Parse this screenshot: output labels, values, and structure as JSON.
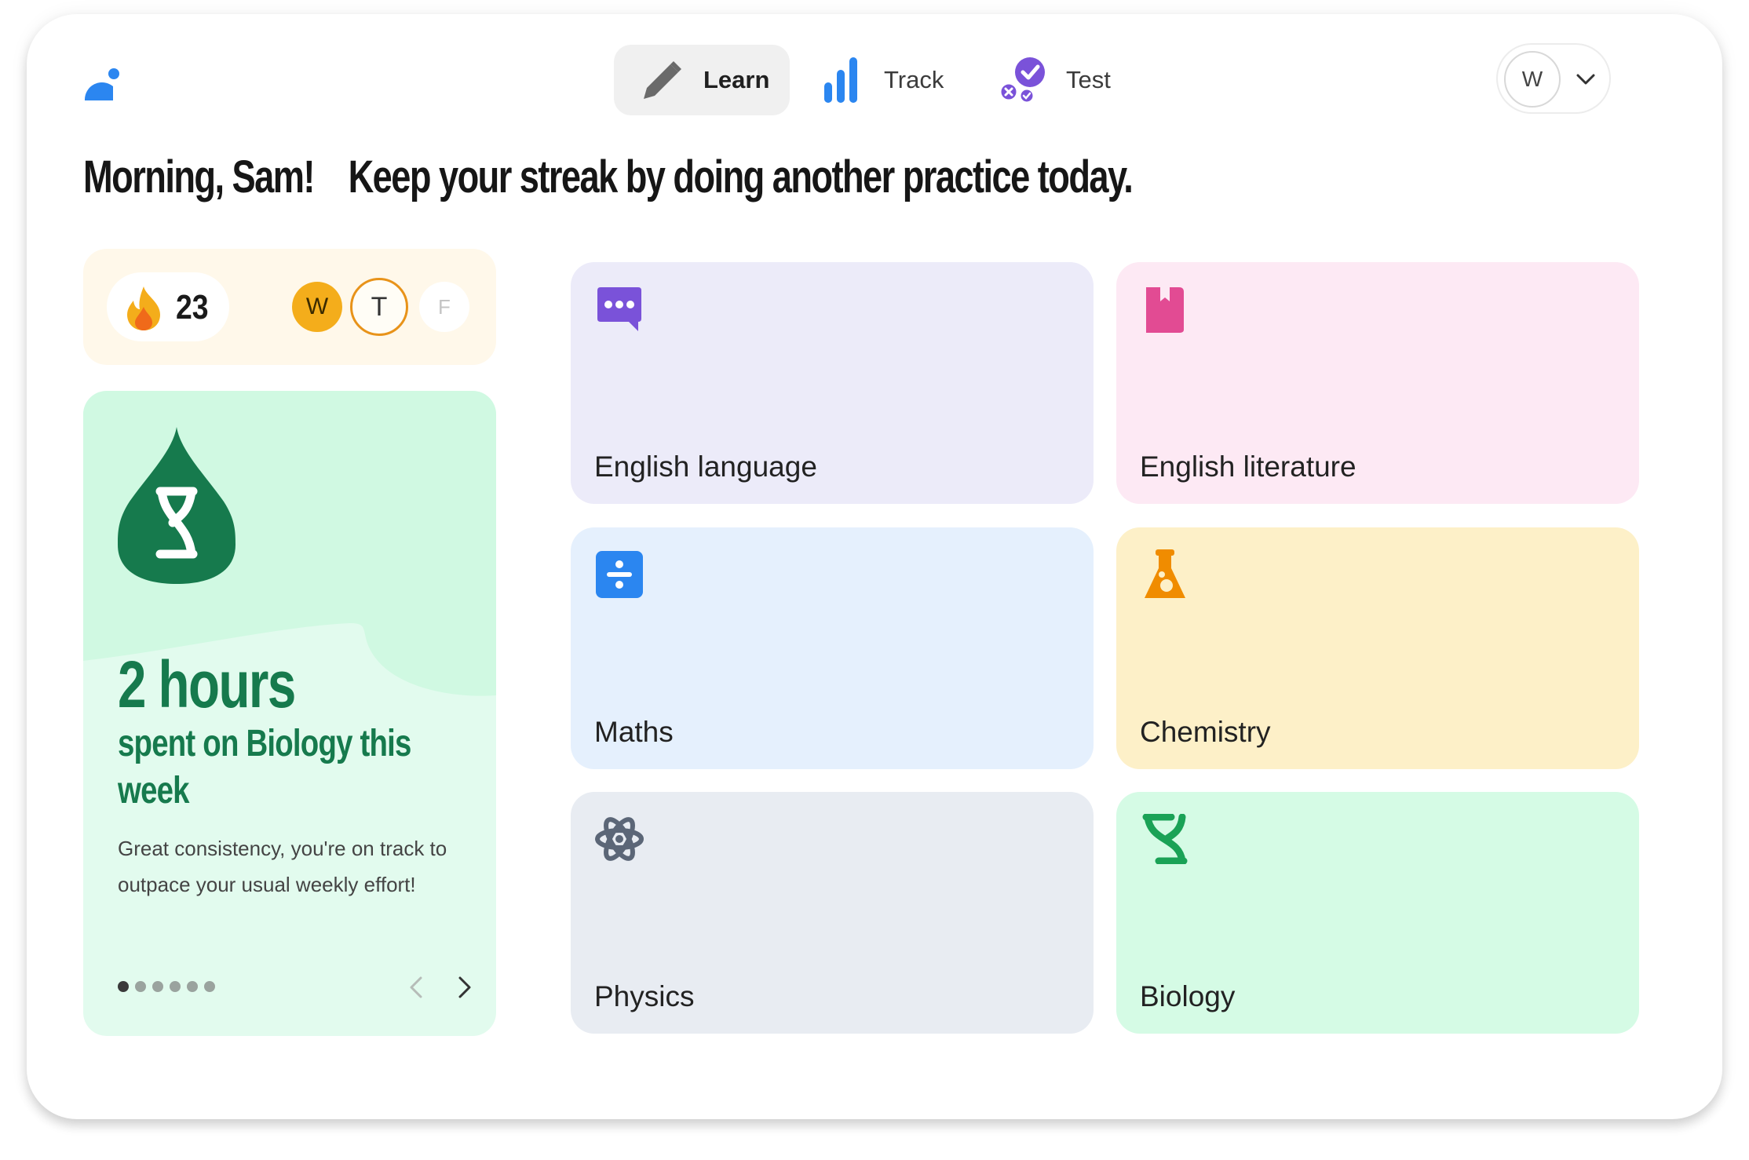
{
  "nav": {
    "items": [
      {
        "label": "Learn",
        "icon": "pencil-icon",
        "active": true
      },
      {
        "label": "Track",
        "icon": "bar-chart-icon",
        "active": false
      },
      {
        "label": "Test",
        "icon": "quiz-check-icon",
        "active": false
      }
    ]
  },
  "user": {
    "initial": "W"
  },
  "greeting": {
    "name": "Morning, Sam!",
    "message": "Keep your streak by doing another practice today."
  },
  "streak": {
    "count": "23",
    "days": [
      {
        "label": "W",
        "state": "done"
      },
      {
        "label": "T",
        "state": "today"
      },
      {
        "label": "F",
        "state": "future"
      }
    ]
  },
  "insight": {
    "headline": "2 hours",
    "subheadline": "spent on Biology this week",
    "body": "Great consistency, you're on track to outpace your usual weekly effort!",
    "slides_total": 6,
    "slide_active": 1
  },
  "subjects": [
    {
      "name": "English language",
      "icon": "speech-bubble-icon",
      "bg": "#ecebf9",
      "accent": "#7a52d9"
    },
    {
      "name": "English literature",
      "icon": "book-icon",
      "bg": "#fde9f4",
      "accent": "#e24b93"
    },
    {
      "name": "Maths",
      "icon": "divide-icon",
      "bg": "#e5f0fd",
      "accent": "#2b86f0"
    },
    {
      "name": "Chemistry",
      "icon": "flask-icon",
      "bg": "#fdf0c8",
      "accent": "#f08c00"
    },
    {
      "name": "Physics",
      "icon": "atom-icon",
      "bg": "#e8ecf2",
      "accent": "#5b6677"
    },
    {
      "name": "Biology",
      "icon": "dna-icon",
      "bg": "#d5fbe5",
      "accent": "#1aa256"
    }
  ],
  "colors": {
    "brand": "#2b86f0",
    "streak_bg": "#fff8ea",
    "insight_bg": "#e2fbee",
    "insight_text": "#167a4d"
  }
}
